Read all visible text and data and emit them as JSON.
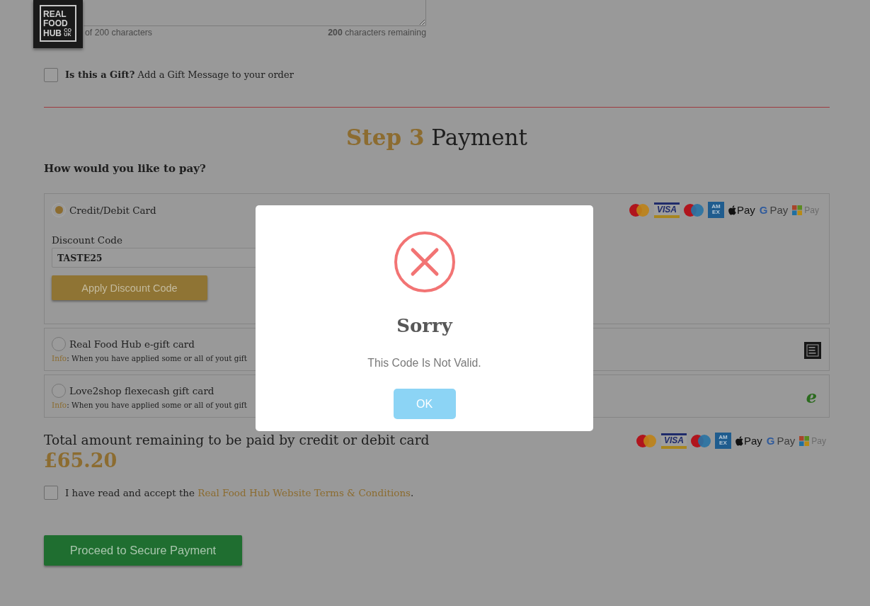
{
  "header": {
    "logo": {
      "lines": [
        "REAL",
        "FOOD",
        "HUB"
      ],
      "suffix": "CO UK"
    }
  },
  "gift_message": {
    "counter": "of 200 characters",
    "remaining": "**200** characters remaining"
  },
  "gift_option": {
    "checked": false,
    "label": "**Is this a Gift?** Add a Gift Message to your order"
  },
  "payment_step": {
    "step": "Step 3",
    "title": "Payment",
    "question": "How would you like to pay?"
  },
  "payment_options": [
    {
      "kind": "card",
      "label": "Credit/Debit Card",
      "selected": true,
      "card_logos": [
        {
          "kind": "mastercard"
        },
        {
          "kind": "visa",
          "text": "VISA"
        },
        {
          "kind": "maestro"
        },
        {
          "kind": "amex",
          "text": "AM EX"
        },
        {
          "kind": "apple-pay",
          "text": "Pay"
        },
        {
          "kind": "google-pay",
          "mark": "G",
          "text": "Pay"
        },
        {
          "kind": "microsoft-pay",
          "text": "Pay"
        }
      ],
      "discount": {
        "label": "Discount Code",
        "value": "TASTE25",
        "button": "Apply Discount Code"
      }
    },
    {
      "kind": "gift-card",
      "label": "Real Food Hub e-gift card",
      "selected": false,
      "info_label": "Info",
      "info_text": ": When you have applied some or all of yout gift",
      "logo": {
        "kind": "hub"
      }
    },
    {
      "kind": "gift-card",
      "label": "Love2shop flexecash gift card",
      "selected": false,
      "info_label": "Info",
      "info_text": ": When you have applied some or all of yout gift",
      "logo": {
        "kind": "flexecash",
        "mark": "e"
      }
    }
  ],
  "total": {
    "label": "Total amount remaining to be paid by credit or debit card",
    "amount": "£65.20",
    "card_logos": [
      {
        "kind": "mastercard"
      },
      {
        "kind": "visa",
        "text": "VISA"
      },
      {
        "kind": "maestro"
      },
      {
        "kind": "amex",
        "text": "AM EX"
      },
      {
        "kind": "apple-pay",
        "text": "Pay"
      },
      {
        "kind": "google-pay",
        "mark": "G",
        "text": "Pay"
      },
      {
        "kind": "microsoft-pay",
        "text": "Pay"
      }
    ]
  },
  "terms": {
    "checked": false,
    "text": "I have read and accept the ",
    "link": "Real Food Hub Website Terms & Conditions",
    "end": "."
  },
  "proceed_button": "Proceed to Secure Payment",
  "dialog": {
    "kind": "error",
    "title": "Sorry",
    "message": "This Code Is Not Valid.",
    "button": "OK"
  }
}
